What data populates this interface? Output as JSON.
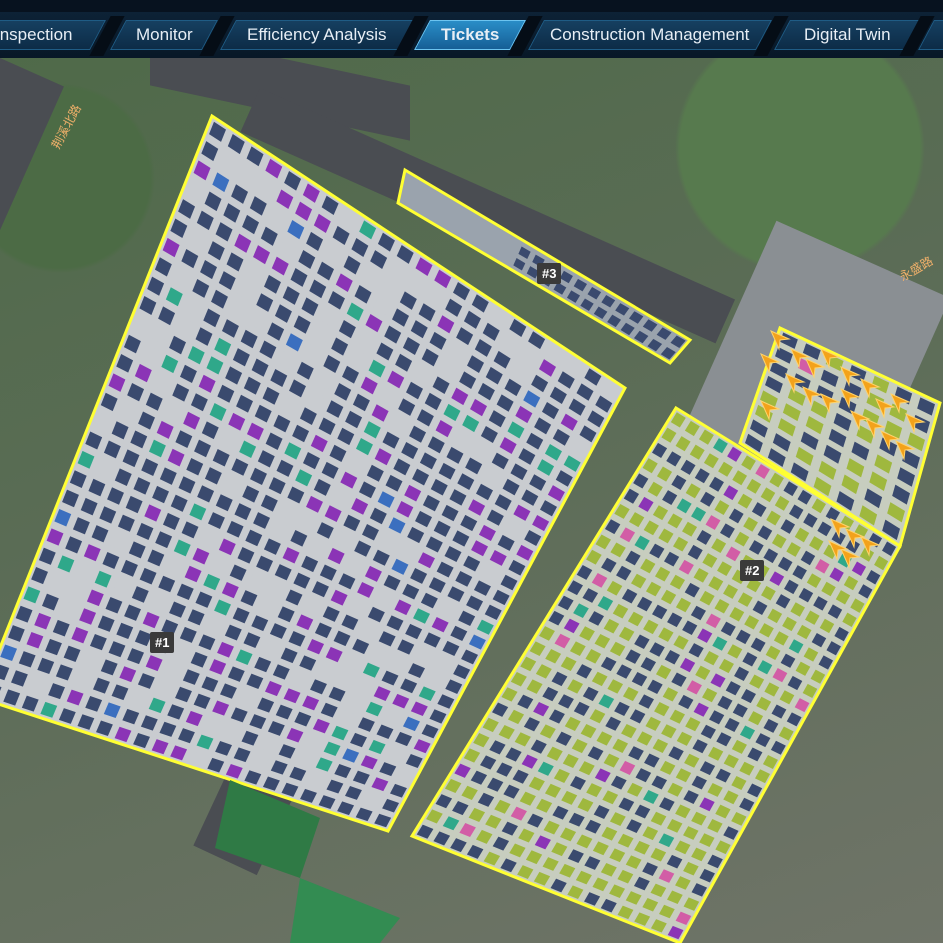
{
  "nav": {
    "tabs": [
      {
        "label": "Inspection",
        "active": false
      },
      {
        "label": "Monitor",
        "active": false
      },
      {
        "label": "Efficiency Analysis",
        "active": false
      },
      {
        "label": "Tickets",
        "active": true
      },
      {
        "label": "Construction Management",
        "active": false
      },
      {
        "label": "Digital Twin",
        "active": false
      }
    ]
  },
  "map": {
    "zones": [
      {
        "label": "#1"
      },
      {
        "label": "#2"
      },
      {
        "label": "#3"
      }
    ],
    "street_labels": [
      "荆溪北路",
      "永盛路"
    ],
    "highlight_color": "#ffff33",
    "alarm_icon": "warning-arrow-icon",
    "alarm_color": "#f3a21b",
    "panel_colors": {
      "normal": "#3a4a6e",
      "fault_purple": "#8b34b6",
      "fault_teal": "#2fa88a",
      "fault_blue": "#3b6fbf",
      "green_panel": "#9fb83e",
      "pink_panel": "#d25da6"
    }
  }
}
